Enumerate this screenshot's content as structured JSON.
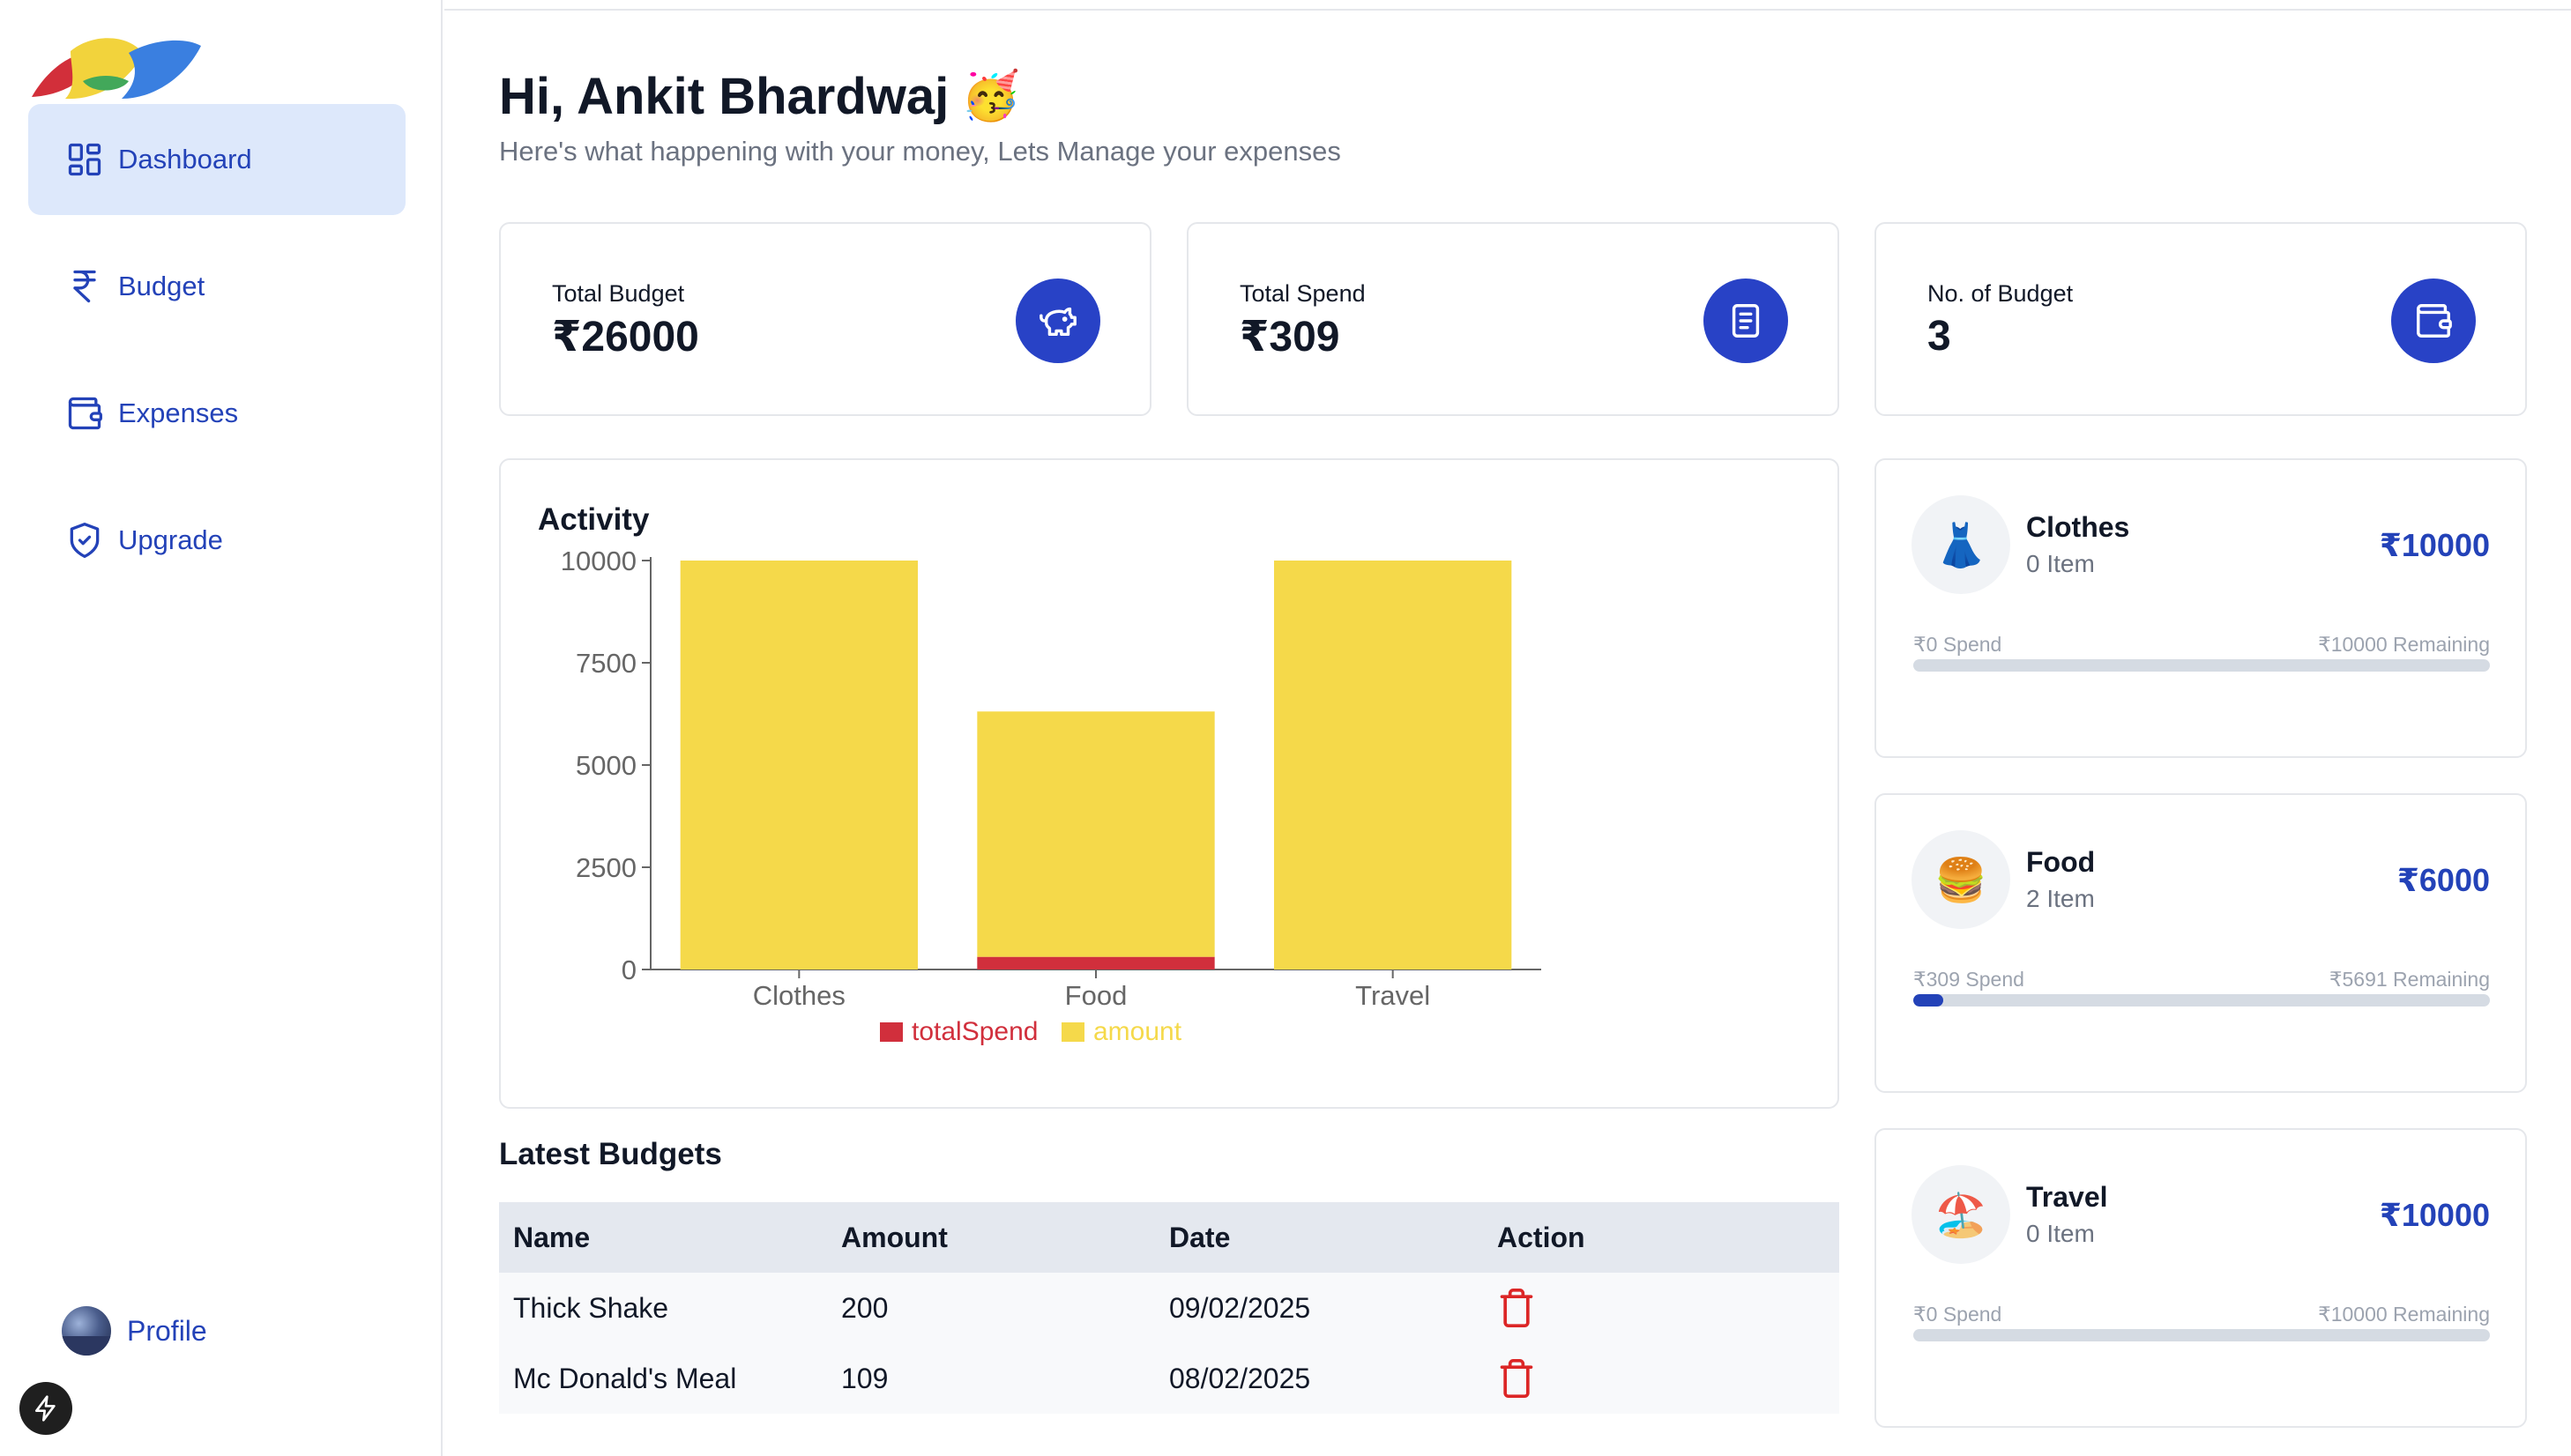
{
  "sidebar": {
    "items": [
      {
        "label": "Dashboard",
        "icon": "dashboard-icon",
        "active": true
      },
      {
        "label": "Budget",
        "icon": "rupee-icon",
        "active": false
      },
      {
        "label": "Expenses",
        "icon": "wallet-icon",
        "active": false
      },
      {
        "label": "Upgrade",
        "icon": "shield-check-icon",
        "active": false
      }
    ],
    "profile_label": "Profile"
  },
  "header": {
    "greeting": "Hi, Ankit Bhardwaj",
    "greeting_emoji": "🥳",
    "subtitle": "Here's what happening with your money, Lets Manage your expenses"
  },
  "stats": [
    {
      "label": "Total Budget",
      "value": "₹26000",
      "icon": "piggy-bank-icon"
    },
    {
      "label": "Total Spend",
      "value": "₹309",
      "icon": "receipt-icon"
    },
    {
      "label": "No. of Budget",
      "value": "3",
      "icon": "wallet-icon"
    }
  ],
  "activity": {
    "title": "Activity"
  },
  "chart_data": {
    "type": "bar",
    "stacked": true,
    "categories": [
      "Clothes",
      "Food",
      "Travel"
    ],
    "series": [
      {
        "name": "totalSpend",
        "values": [
          0,
          309,
          0
        ],
        "color": "#d12f3c"
      },
      {
        "name": "amount",
        "values": [
          10000,
          6000,
          10000
        ],
        "color": "#f5d94a"
      }
    ],
    "yticks": [
      "0",
      "2500",
      "5000",
      "7500",
      "10000"
    ],
    "ylim": [
      0,
      10000
    ],
    "legend": "bottom-center",
    "grid": false
  },
  "latest": {
    "title": "Latest Budgets",
    "columns": [
      "Name",
      "Amount",
      "Date",
      "Action"
    ],
    "rows": [
      {
        "name": "Thick Shake",
        "amount": "200",
        "date": "09/02/2025"
      },
      {
        "name": "Mc Donald's Meal",
        "amount": "109",
        "date": "08/02/2025"
      }
    ]
  },
  "budgets": [
    {
      "emoji": "👗",
      "name": "Clothes",
      "items": "0 Item",
      "amount": "₹10000",
      "spend": "₹0 Spend",
      "remaining": "₹10000 Remaining",
      "progress": 0
    },
    {
      "emoji": "🍔",
      "name": "Food",
      "items": "2 Item",
      "amount": "₹6000",
      "spend": "₹309 Spend",
      "remaining": "₹5691 Remaining",
      "progress": 0.0515
    },
    {
      "emoji": "🏖️",
      "name": "Travel",
      "items": "0 Item",
      "amount": "₹10000",
      "spend": "₹0 Spend",
      "remaining": "₹10000 Remaining",
      "progress": 0
    }
  ],
  "colors": {
    "accent": "#2342b8",
    "icon_circle": "#2842c6",
    "active_nav_bg": "#dde8fb"
  }
}
